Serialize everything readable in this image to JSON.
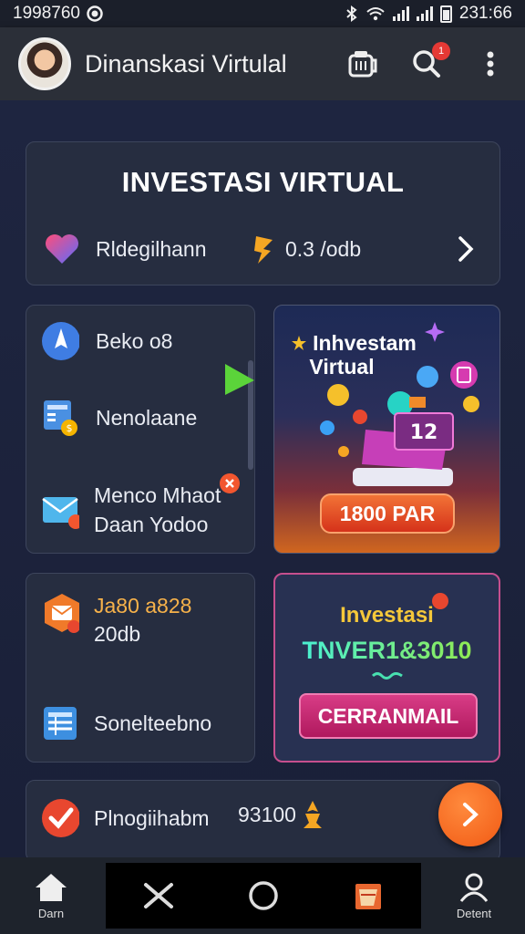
{
  "status_bar": {
    "left_text": "1998760",
    "time": "231:66"
  },
  "app_bar": {
    "title": "Dinanskasi Virtulal",
    "notification_count": "1"
  },
  "hero_card": {
    "title": "INVESTASI VIRTUAL",
    "left_label": "Rldegilhann",
    "right_value": "0.3 /odb"
  },
  "menu_card": {
    "items": [
      {
        "label": "Beko o8"
      },
      {
        "label": "Nenolaane"
      },
      {
        "label_line1": "Menco Mhaot",
        "label_line2": "Daan Yodoo"
      }
    ]
  },
  "promo_card": {
    "title_line1": "Inhvestam",
    "title_line2": "Virtual",
    "tile_text": "12",
    "button_label": "1800 PAR"
  },
  "stats_card": {
    "value_line1": "Ja80 a828",
    "value_line2": "20db",
    "link_label": "Sonelteebno"
  },
  "invest_card": {
    "title": "Investasi",
    "code": "TNVER1&3010",
    "button_label": "CERRANMAIL"
  },
  "summary_card": {
    "label": "Plnogiihabm",
    "value": "93100"
  },
  "bottom_nav": {
    "home_label": "Darn",
    "account_label": "Detent"
  },
  "colors": {
    "accent_orange": "#f15a14",
    "promo_border": "#c64f8e",
    "button_pink": "#c4256f",
    "code_gradient_start": "#3ff0e6",
    "code_gradient_end": "#9bea3f"
  }
}
